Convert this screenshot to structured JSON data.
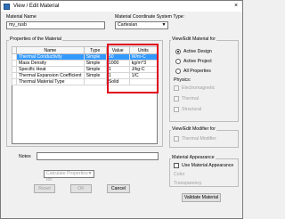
{
  "window": {
    "title": "View / Edit Material",
    "close_glyph": "×"
  },
  "material_name": {
    "label": "Material Name",
    "value": "my_rusb"
  },
  "coord_system": {
    "label": "Material Coordinate System Type:",
    "value": "Cartesian"
  },
  "properties": {
    "title": "Properties of the Material",
    "columns": [
      "Name",
      "Type",
      "Value",
      "Units"
    ],
    "rows": [
      {
        "name": "Thermal Conductivity",
        "type": "Simple",
        "value": "50",
        "units": "W/m-C"
      },
      {
        "name": "Mass Density",
        "type": "Simple",
        "value": "1000",
        "units": "kg/m^3"
      },
      {
        "name": "Specific Heat",
        "type": "Simple",
        "value": "1",
        "units": "J/kg-C"
      },
      {
        "name": "Thermal Expansion Coefficient",
        "type": "Simple",
        "value": "1",
        "units": "1/C"
      },
      {
        "name": "Thermal Material Type",
        "type": "",
        "value": "Solid",
        "units": ""
      }
    ]
  },
  "view_edit_for": {
    "title": "View/Edit Material for",
    "options": [
      "Active Design",
      "Active Project",
      "All Properties"
    ],
    "selected": "Active Design",
    "physics_label": "Physics:",
    "physics": [
      "Electromagnetic",
      "Thermal",
      "Structural"
    ]
  },
  "view_edit_modifier": {
    "title": "View/Edit Modifier for",
    "option": "Thermal Modifier"
  },
  "material_appearance": {
    "title": "Material Appearance",
    "checkbox": "Use Material Appearance",
    "color_label": "Color",
    "transparency_label": "Transparency"
  },
  "notes": {
    "label": "Notes"
  },
  "calculate": {
    "value": "Calculate Properties for:"
  },
  "buttons": {
    "validate": "Validate Material",
    "reset": "Reset",
    "ok": "OK",
    "cancel": "Cancel"
  }
}
